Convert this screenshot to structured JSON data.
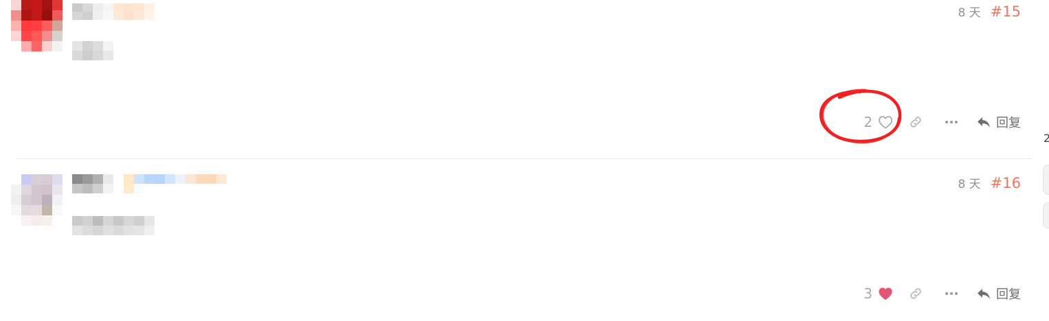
{
  "posts": [
    {
      "age": "8 天",
      "number": "#15",
      "likes": "2",
      "liked": false,
      "reply_label": "回复"
    },
    {
      "age": "8 天",
      "number": "#16",
      "likes": "3",
      "liked": true,
      "reply_label": "回复"
    }
  ],
  "sidebar_edge": {
    "digit": "2"
  },
  "icons": {
    "like_empty": "heart-outline-icon",
    "like_filled": "heart-filled-icon",
    "link": "link-icon",
    "more": "ellipsis-icon",
    "reply": "reply-arrow-icon"
  },
  "colors": {
    "post_number": "#f0765f",
    "heart_filled": "#e45575",
    "annotation_ring": "#ee2222",
    "muted_text": "#919191"
  }
}
